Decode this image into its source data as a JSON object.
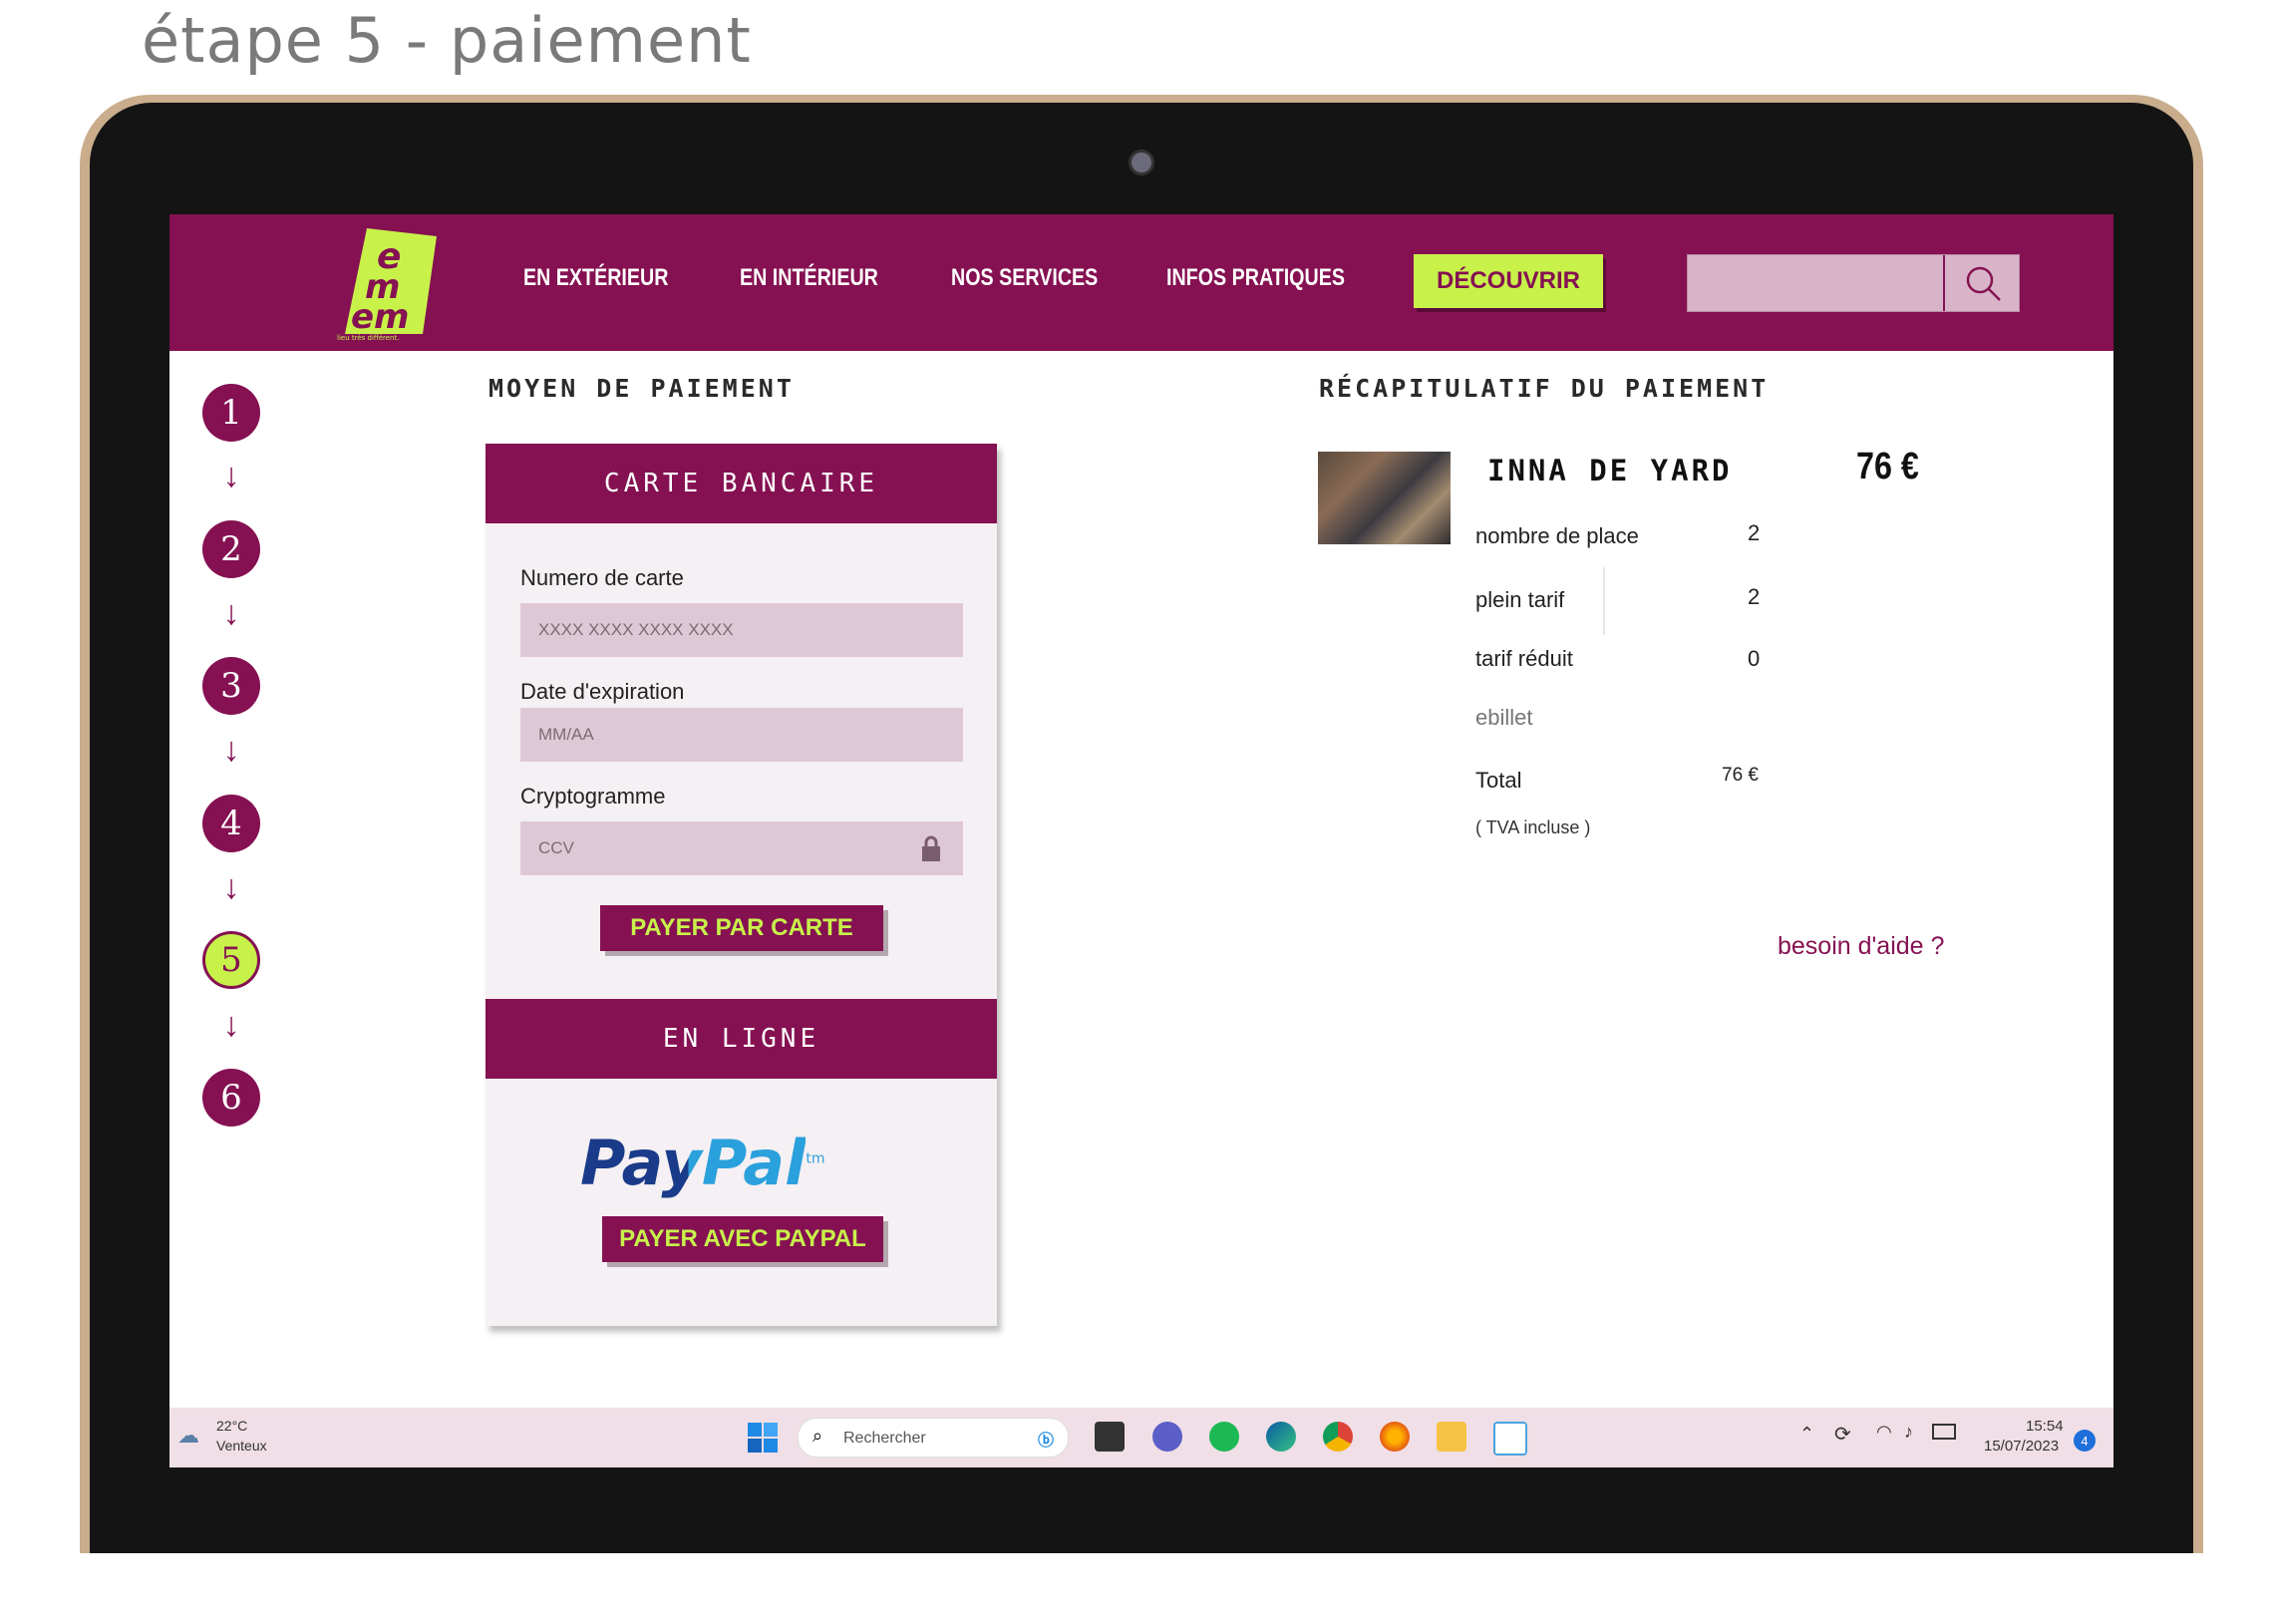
{
  "caption": "étape 5 - paiement",
  "brand": {
    "logo_letters": "e m em",
    "logo_tagline": "lieu très différent"
  },
  "nav": {
    "items": [
      "EN EXTÉRIEUR",
      "EN INTÉRIEUR",
      "NOS SERVICES",
      "INFOS PRATIQUES"
    ],
    "discover": "DÉCOUVRIR",
    "search_icon": "search-icon"
  },
  "steps": [
    "1",
    "2",
    "3",
    "4",
    "5",
    "6"
  ],
  "active_step": 5,
  "payment": {
    "title": "MOYEN DE PAIEMENT",
    "card_section": "CARTE BANCAIRE",
    "card_number_label": "Numero de carte",
    "card_number_placeholder": "XXXX XXXX XXXX XXXX",
    "expiry_label": "Date d'expiration",
    "expiry_placeholder": "MM/AA",
    "cvv_label": "Cryptogramme",
    "cvv_placeholder": "CCV",
    "pay_card_button": "PAYER PAR CARTE",
    "online_section": "EN LIGNE",
    "paypal_logo": "PayPal",
    "paypal_tm": "tm",
    "pay_paypal_button": "PAYER AVEC PAYPAL"
  },
  "summary": {
    "title": "RÉCAPITULATIF  DU PAIEMENT",
    "event": "INNA DE YARD",
    "price": "76 €",
    "rows": [
      {
        "label": "nombre de place",
        "value": "2"
      },
      {
        "label": "plein tarif",
        "value": "2"
      },
      {
        "label": "tarif réduit",
        "value": "0"
      },
      {
        "label": "ebillet",
        "value": ""
      },
      {
        "label": "Total",
        "value": "76 €"
      }
    ],
    "vat": "( TVA incluse )",
    "help": "besoin d'aide ?"
  },
  "taskbar": {
    "weather_temp": "22°C",
    "weather_desc": "Venteux",
    "search_placeholder": "Rechercher",
    "time": "15:54",
    "date": "15/07/2023",
    "notification_count": "4"
  },
  "colors": {
    "brand": "#851152",
    "accent": "#c8f24a",
    "field": "#dfc8d5"
  }
}
